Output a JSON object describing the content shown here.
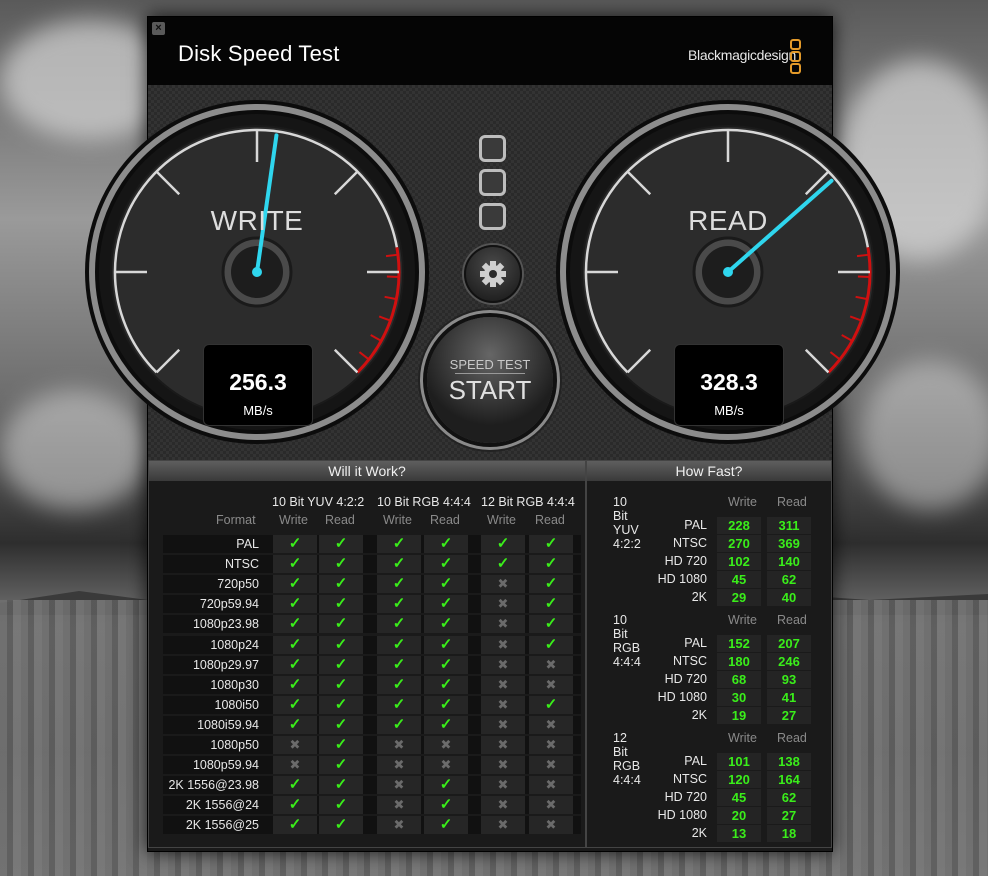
{
  "app": {
    "title": "Disk Speed Test",
    "brand": "Blackmagicdesign",
    "close": "×"
  },
  "write_gauge": {
    "label": "WRITE",
    "value": "256.3",
    "unit": "MB/s",
    "needle_fraction": 0.53
  },
  "read_gauge": {
    "label": "READ",
    "value": "328.3",
    "unit": "MB/s",
    "needle_fraction": 0.68
  },
  "start_button": {
    "top": "SPEED TEST",
    "main": "START"
  },
  "will_it_work": {
    "title": "Will it Work?",
    "format_header": "Format",
    "groups": [
      {
        "name": "10 Bit YUV 4:2:2",
        "write": "Write",
        "read": "Read"
      },
      {
        "name": "10 Bit RGB 4:4:4",
        "write": "Write",
        "read": "Read"
      },
      {
        "name": "12 Bit RGB 4:4:4",
        "write": "Write",
        "read": "Read"
      }
    ],
    "check": "✓",
    "cross": "✖",
    "rows": [
      {
        "format": "PAL",
        "cells": [
          1,
          1,
          1,
          1,
          1,
          1
        ]
      },
      {
        "format": "NTSC",
        "cells": [
          1,
          1,
          1,
          1,
          1,
          1
        ]
      },
      {
        "format": "720p50",
        "cells": [
          1,
          1,
          1,
          1,
          0,
          1
        ]
      },
      {
        "format": "720p59.94",
        "cells": [
          1,
          1,
          1,
          1,
          0,
          1
        ]
      },
      {
        "format": "1080p23.98",
        "cells": [
          1,
          1,
          1,
          1,
          0,
          1
        ]
      },
      {
        "format": "1080p24",
        "cells": [
          1,
          1,
          1,
          1,
          0,
          1
        ]
      },
      {
        "format": "1080p29.97",
        "cells": [
          1,
          1,
          1,
          1,
          0,
          0
        ]
      },
      {
        "format": "1080p30",
        "cells": [
          1,
          1,
          1,
          1,
          0,
          0
        ]
      },
      {
        "format": "1080i50",
        "cells": [
          1,
          1,
          1,
          1,
          0,
          1
        ]
      },
      {
        "format": "1080i59.94",
        "cells": [
          1,
          1,
          1,
          1,
          0,
          0
        ]
      },
      {
        "format": "1080p50",
        "cells": [
          0,
          1,
          0,
          0,
          0,
          0
        ]
      },
      {
        "format": "1080p59.94",
        "cells": [
          0,
          1,
          0,
          0,
          0,
          0
        ]
      },
      {
        "format": "2K 1556@23.98",
        "cells": [
          1,
          1,
          0,
          1,
          0,
          0
        ]
      },
      {
        "format": "2K 1556@24",
        "cells": [
          1,
          1,
          0,
          1,
          0,
          0
        ]
      },
      {
        "format": "2K 1556@25",
        "cells": [
          1,
          1,
          0,
          1,
          0,
          0
        ]
      }
    ]
  },
  "how_fast": {
    "title": "How Fast?",
    "write": "Write",
    "read": "Read",
    "groups": [
      {
        "name": "10 Bit YUV 4:2:2",
        "rows": [
          {
            "label": "PAL",
            "write": "228",
            "read": "311"
          },
          {
            "label": "NTSC",
            "write": "270",
            "read": "369"
          },
          {
            "label": "HD 720",
            "write": "102",
            "read": "140"
          },
          {
            "label": "HD 1080",
            "write": "45",
            "read": "62"
          },
          {
            "label": "2K",
            "write": "29",
            "read": "40"
          }
        ]
      },
      {
        "name": "10 Bit RGB 4:4:4",
        "rows": [
          {
            "label": "PAL",
            "write": "152",
            "read": "207"
          },
          {
            "label": "NTSC",
            "write": "180",
            "read": "246"
          },
          {
            "label": "HD 720",
            "write": "68",
            "read": "93"
          },
          {
            "label": "HD 1080",
            "write": "30",
            "read": "41"
          },
          {
            "label": "2K",
            "write": "19",
            "read": "27"
          }
        ]
      },
      {
        "name": "12 Bit RGB 4:4:4",
        "rows": [
          {
            "label": "PAL",
            "write": "101",
            "read": "138"
          },
          {
            "label": "NTSC",
            "write": "120",
            "read": "164"
          },
          {
            "label": "HD 720",
            "write": "45",
            "read": "62"
          },
          {
            "label": "HD 1080",
            "write": "20",
            "read": "27"
          },
          {
            "label": "2K",
            "write": "13",
            "read": "18"
          }
        ]
      }
    ]
  }
}
